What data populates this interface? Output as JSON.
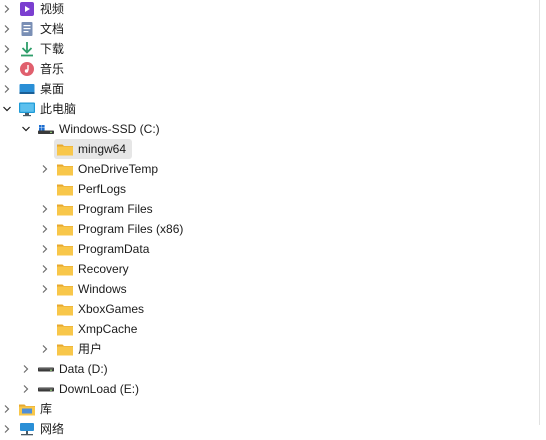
{
  "tree": [
    {
      "label": "视频",
      "icon": "video-library-icon",
      "chevron": "right"
    },
    {
      "label": "文档",
      "icon": "documents-icon",
      "chevron": "right"
    },
    {
      "label": "下载",
      "icon": "download-arrow-icon",
      "chevron": "right"
    },
    {
      "label": "音乐",
      "icon": "music-icon",
      "chevron": "right"
    },
    {
      "label": "桌面",
      "icon": "desktop-icon",
      "chevron": "right"
    },
    {
      "label": "此电脑",
      "icon": "this-pc-icon",
      "chevron": "down"
    },
    {
      "label": "Windows-SSD (C:)",
      "icon": "drive-c-icon",
      "chevron": "down"
    },
    {
      "label": "mingw64",
      "icon": "folder-icon",
      "chevron": "none",
      "selected": true
    },
    {
      "label": "OneDriveTemp",
      "icon": "folder-icon",
      "chevron": "right"
    },
    {
      "label": "PerfLogs",
      "icon": "folder-icon",
      "chevron": "none"
    },
    {
      "label": "Program Files",
      "icon": "folder-icon",
      "chevron": "right"
    },
    {
      "label": "Program Files (x86)",
      "icon": "folder-icon",
      "chevron": "right"
    },
    {
      "label": "ProgramData",
      "icon": "folder-icon",
      "chevron": "right"
    },
    {
      "label": "Recovery",
      "icon": "folder-icon",
      "chevron": "right"
    },
    {
      "label": "Windows",
      "icon": "folder-icon",
      "chevron": "right"
    },
    {
      "label": "XboxGames",
      "icon": "folder-icon",
      "chevron": "none"
    },
    {
      "label": "XmpCache",
      "icon": "folder-icon",
      "chevron": "none"
    },
    {
      "label": "用户",
      "icon": "folder-icon",
      "chevron": "right"
    },
    {
      "label": "Data (D:)",
      "icon": "drive-icon",
      "chevron": "right"
    },
    {
      "label": "DownLoad (E:)",
      "icon": "drive-icon",
      "chevron": "right"
    },
    {
      "label": "库",
      "icon": "libraries-icon",
      "chevron": "right"
    },
    {
      "label": "网络",
      "icon": "network-icon",
      "chevron": "right"
    }
  ],
  "colors": {
    "folder": "#f8c74a",
    "folder_dark": "#e7a92e",
    "selection": "#e6e6e6",
    "chevron": "#6a6a6a",
    "download_arrow": "#2e9e6a",
    "video": "#7b3fd0",
    "music": "#e05f6d",
    "desktop": "#2a8fd6",
    "pc": "#1e9ad6"
  }
}
